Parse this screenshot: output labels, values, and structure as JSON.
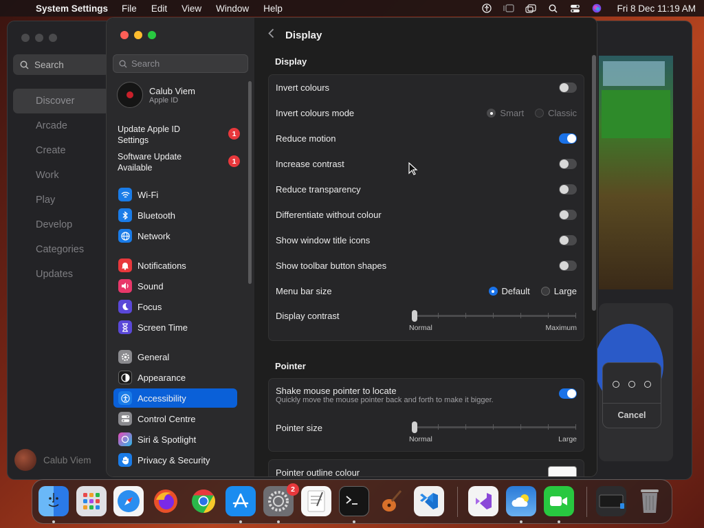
{
  "menubar": {
    "app_name": "System Settings",
    "menus": [
      "File",
      "Edit",
      "View",
      "Window",
      "Help"
    ],
    "clock": "Fri 8 Dec  11:19 AM"
  },
  "appstore": {
    "search_placeholder": "Search",
    "nav": [
      "Discover",
      "Arcade",
      "Create",
      "Work",
      "Play",
      "Develop",
      "Categories",
      "Updates"
    ],
    "active_nav": "Discover",
    "user_name": "Calub Viem",
    "popup_cancel": "Cancel"
  },
  "sidebar": {
    "search_placeholder": "Search",
    "account": {
      "name": "Calub Viem",
      "sub": "Apple ID"
    },
    "notices": [
      {
        "label": "Update Apple ID Settings",
        "badge": "1"
      },
      {
        "label": "Software Update Available",
        "badge": "1"
      }
    ],
    "items": [
      {
        "label": "Wi-Fi",
        "icon": "wifi-icon",
        "color": "#1a7ce8"
      },
      {
        "label": "Bluetooth",
        "icon": "bluetooth-icon",
        "color": "#1a7ce8"
      },
      {
        "label": "Network",
        "icon": "globe-icon",
        "color": "#1a7ce8"
      },
      {
        "label": "Notifications",
        "icon": "bell-icon",
        "color": "#e8383c"
      },
      {
        "label": "Sound",
        "icon": "speaker-icon",
        "color": "#e8386a"
      },
      {
        "label": "Focus",
        "icon": "moon-icon",
        "color": "#5a48d8"
      },
      {
        "label": "Screen Time",
        "icon": "hourglass-icon",
        "color": "#5a48d8"
      },
      {
        "label": "General",
        "icon": "gear-icon",
        "color": "#8a8a8e"
      },
      {
        "label": "Appearance",
        "icon": "appearance-icon",
        "color": "#1a1a1a"
      },
      {
        "label": "Accessibility",
        "icon": "accessibility-icon",
        "color": "#1a7ce8"
      },
      {
        "label": "Control Centre",
        "icon": "control-centre-icon",
        "color": "#8a8a8e"
      },
      {
        "label": "Siri & Spotlight",
        "icon": "siri-icon",
        "color": "#8a48c8"
      },
      {
        "label": "Privacy & Security",
        "icon": "hand-icon",
        "color": "#1a7ce8"
      }
    ],
    "active_item": "Accessibility"
  },
  "content": {
    "title": "Display",
    "display_section": "Display",
    "rows": {
      "invert_colours": {
        "label": "Invert colours",
        "on": false
      },
      "invert_mode": {
        "label": "Invert colours mode",
        "options": [
          "Smart",
          "Classic"
        ],
        "selected": "Smart"
      },
      "reduce_motion": {
        "label": "Reduce motion",
        "on": true
      },
      "increase_contrast": {
        "label": "Increase contrast",
        "on": false
      },
      "reduce_transparency": {
        "label": "Reduce transparency",
        "on": false
      },
      "differentiate": {
        "label": "Differentiate without colour",
        "on": false
      },
      "title_icons": {
        "label": "Show window title icons",
        "on": false
      },
      "toolbar_shapes": {
        "label": "Show toolbar button shapes",
        "on": false
      },
      "menu_bar_size": {
        "label": "Menu bar size",
        "options": [
          "Default",
          "Large"
        ],
        "selected": "Default"
      },
      "display_contrast": {
        "label": "Display contrast",
        "min_label": "Normal",
        "max_label": "Maximum",
        "value": 0
      }
    },
    "pointer_section": "Pointer",
    "pointer": {
      "shake": {
        "label": "Shake mouse pointer to locate",
        "sub": "Quickly move the mouse pointer back and forth to make it bigger.",
        "on": true
      },
      "size": {
        "label": "Pointer size",
        "min_label": "Normal",
        "max_label": "Large",
        "value": 0
      },
      "outline": {
        "label": "Pointer outline colour"
      }
    }
  },
  "dock": {
    "apps": [
      {
        "name": "finder-icon",
        "color": "#2a8cf0",
        "glyph": "☺"
      },
      {
        "name": "launchpad-icon",
        "color": "#d8d8d8",
        "glyph": "▦"
      },
      {
        "name": "safari-icon",
        "color": "#2a8cf0",
        "glyph": "✦"
      },
      {
        "name": "firefox-icon",
        "color": "#e8602a",
        "glyph": "◉"
      },
      {
        "name": "chrome-icon",
        "color": "#f0f0f0",
        "glyph": "◎"
      },
      {
        "name": "app-store-icon",
        "color": "#1a8cf0",
        "glyph": "A"
      },
      {
        "name": "system-settings-icon",
        "color": "#6a6a6e",
        "glyph": "⚙"
      },
      {
        "name": "textedit-icon",
        "color": "#f4f4f4",
        "glyph": "✎"
      },
      {
        "name": "terminal-icon",
        "color": "#1a1a1a",
        "glyph": ">_"
      },
      {
        "name": "garageband-icon",
        "color": "#3a2a1a",
        "glyph": "♪"
      },
      {
        "name": "vscode-icon",
        "color": "#1a6ad0",
        "glyph": "❮❯"
      },
      {
        "name": "visual-studio-icon",
        "color": "#f0f0f0",
        "glyph": "∞"
      },
      {
        "name": "weather-icon",
        "color": "#2a7ad8",
        "glyph": "☁"
      },
      {
        "name": "facetime-icon",
        "color": "#28c840",
        "glyph": "■"
      },
      {
        "name": "preview-icon",
        "color": "#2a2a2c",
        "glyph": "▭"
      },
      {
        "name": "trash-icon",
        "color": "#6a6a6e",
        "glyph": "🗑"
      }
    ],
    "settings_badge": "2"
  }
}
